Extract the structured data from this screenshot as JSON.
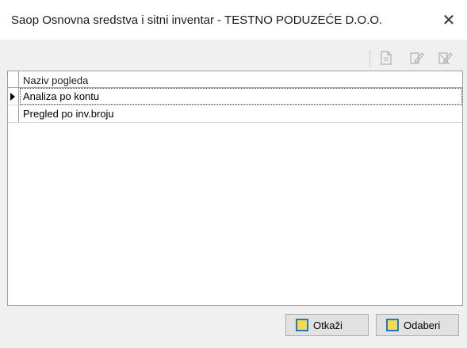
{
  "window": {
    "title": "Saop Osnovna sredstva i sitni inventar - TESTNO PODUZEĆE D.O.O.",
    "close_glyph": "✕"
  },
  "toolbar": {
    "icons": [
      "new-document-icon",
      "edit-document-icon",
      "delete-document-icon"
    ]
  },
  "grid": {
    "column_header": "Naziv pogleda",
    "rows": [
      {
        "label": "Analiza po kontu",
        "selected": true
      },
      {
        "label": "Pregled po inv.broju",
        "selected": false
      }
    ]
  },
  "buttons": {
    "cancel_label": "Otkaži",
    "select_label": "Odaberi"
  },
  "colors": {
    "accent": "#1e78c8",
    "button_icon_fill": "#f7d94c"
  }
}
